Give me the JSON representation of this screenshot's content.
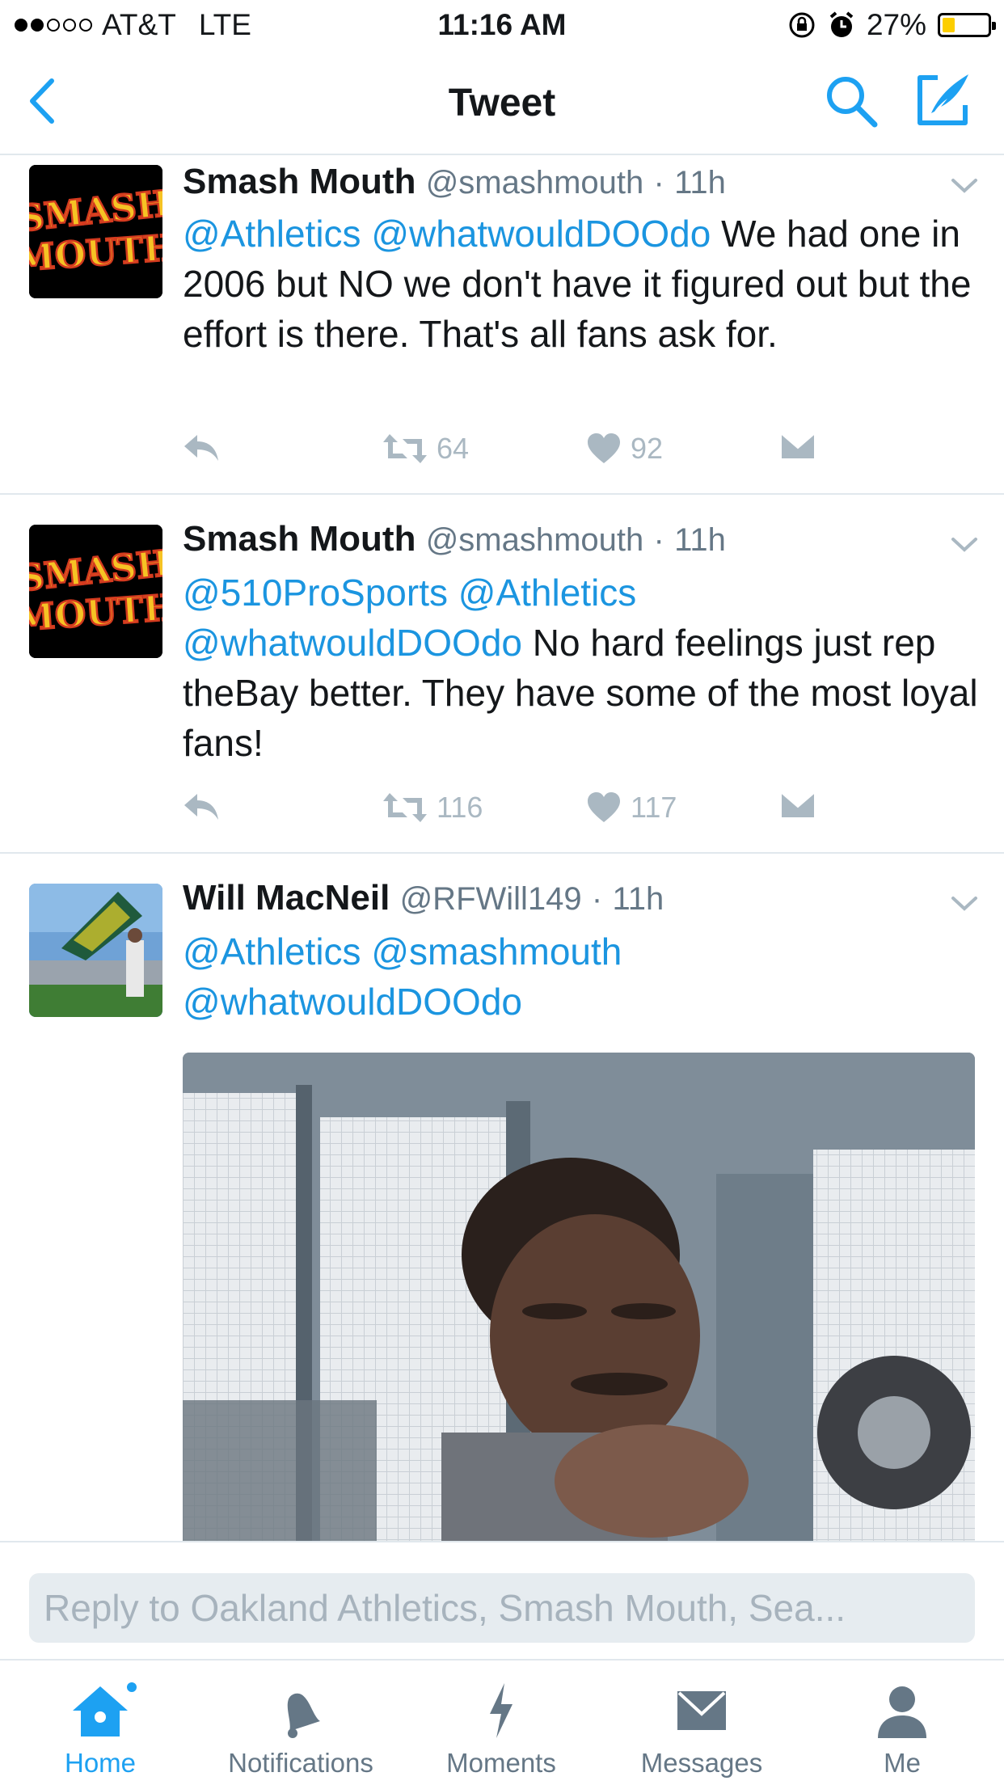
{
  "status_bar": {
    "carrier": "AT&T",
    "network": "LTE",
    "time": "11:16 AM",
    "battery": "27%",
    "battery_level": 0.27,
    "signal_bars_filled": 2,
    "signal_bars_total": 5
  },
  "nav": {
    "title": "Tweet",
    "back_icon": "chevron-left-icon",
    "search_icon": "search-icon",
    "compose_icon": "compose-icon"
  },
  "tweets": [
    {
      "name": "Smash Mouth",
      "handle": "@smashmouth",
      "separator": "·",
      "time": "11h",
      "avatar_text": [
        "SMASH",
        "MOUTH"
      ],
      "mentions": [
        "@Athletics",
        "@whatwouldDOOdo"
      ],
      "text": "We had one in 2006 but NO we don't have it figured out but the effort is there. That's all fans ask for.",
      "retweets": "64",
      "likes": "92"
    },
    {
      "name": "Smash Mouth",
      "handle": "@smashmouth",
      "separator": "·",
      "time": "11h",
      "avatar_text": [
        "SMASH",
        "MOUTH"
      ],
      "mentions": [
        "@510ProSports",
        "@Athletics",
        "@whatwouldDOOdo"
      ],
      "text": "No hard feelings just rep theBay better. They have some of the most loyal fans!",
      "retweets": "116",
      "likes": "117"
    },
    {
      "name": "Will MacNeil",
      "handle": "@RFWill149",
      "separator": "·",
      "time": "11h",
      "mentions": [
        "@Athletics",
        "@smashmouth",
        "@whatwouldDOOdo"
      ],
      "text": ""
    }
  ],
  "reply": {
    "placeholder": "Reply to Oakland Athletics, Smash Mouth, Sea..."
  },
  "tabbar": [
    {
      "label": "Home",
      "icon": "home-icon",
      "active": true
    },
    {
      "label": "Notifications",
      "icon": "bell-icon",
      "active": false
    },
    {
      "label": "Moments",
      "icon": "lightning-icon",
      "active": false
    },
    {
      "label": "Messages",
      "icon": "envelope-icon",
      "active": false
    },
    {
      "label": "Me",
      "icon": "person-icon",
      "active": false
    }
  ],
  "colors": {
    "accent": "#1da1f2",
    "mention": "#1b95e0",
    "muted": "#657786",
    "divider": "#e1e8ed",
    "avatar_text": "#f6c324",
    "avatar_outline": "#d33a1f"
  }
}
